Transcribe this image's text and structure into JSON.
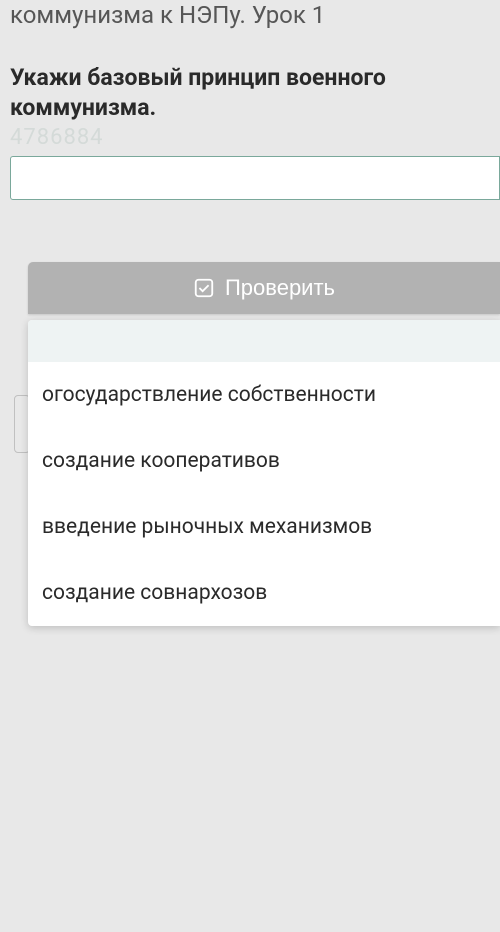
{
  "page": {
    "title": "коммунизма к НЭПу. Урок 1"
  },
  "question": {
    "text": "Укажи базовый принцип военного коммунизма.",
    "watermark": "4786884"
  },
  "input": {
    "value": ""
  },
  "check_button": {
    "label": "Проверить"
  },
  "dropdown": {
    "items": [
      {
        "label": "огосударствление собственности"
      },
      {
        "label": "создание кооперативов"
      },
      {
        "label": "введение рыночных механизмов"
      },
      {
        "label": "создание совнархозов"
      }
    ]
  }
}
